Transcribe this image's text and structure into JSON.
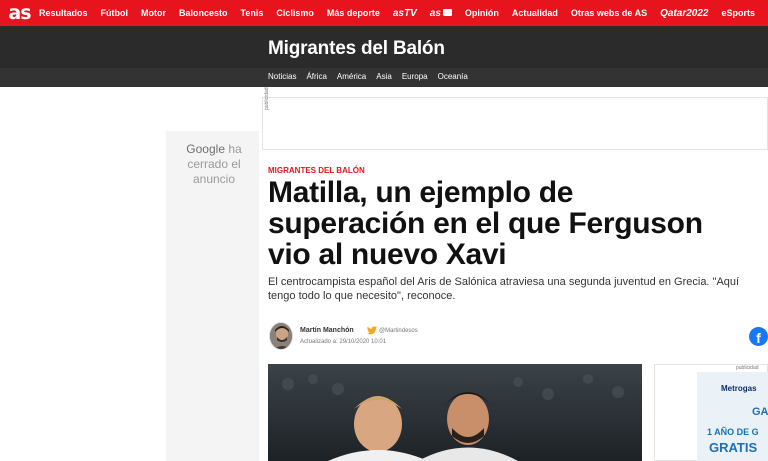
{
  "topnav": {
    "logo": "as",
    "links": [
      "Resultados",
      "Fútbol",
      "Motor",
      "Baloncesto",
      "Tenis",
      "Ciclismo",
      "Más deporte"
    ],
    "brand_astv": "asTV",
    "brand_asfoto": "as",
    "links2": [
      "Opinión",
      "Actualidad",
      "Otras webs de AS"
    ],
    "brand_qatar": "Qatar2022",
    "last": "eSports"
  },
  "section": {
    "title": "Migrantes del Balón",
    "subnav": [
      "Noticias",
      "África",
      "América",
      "Asia",
      "Europa",
      "Oceanía"
    ]
  },
  "left_ad": {
    "google": "Google",
    "message": "ha cerrado el anuncio"
  },
  "ads": {
    "label": "publicidad"
  },
  "article": {
    "kicker": "MIGRANTES DEL BALÓN",
    "headline": "Matilla, un ejemplo de superación en el que Ferguson vio al nuevo Xavi",
    "subtitle": "El centrocampista español del Aris de Salónica atraviesa una segunda juventud en Grecia. \"Aquí tengo todo lo que necesito\", reconoce.",
    "author": "Martín Manchón",
    "twitter_handle": "@Martindesos",
    "updated": "Actualizado a: 29/10/2020 10:01"
  },
  "share": {
    "facebook": "f"
  },
  "right_ad": {
    "brand": "Metrogas",
    "line1": "GA",
    "line2": "1 AÑO DE G",
    "line3": "GRATIS"
  },
  "colors": {
    "brand_red": "#e8141d",
    "dark_bar": "#2b2b2b",
    "facebook": "#1877f2",
    "twitter": "#1da1f2"
  }
}
